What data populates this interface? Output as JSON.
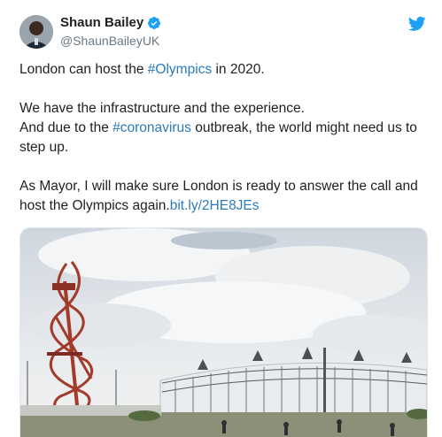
{
  "author": {
    "display_name": "Shaun Bailey",
    "handle": "@ShaunBaileyUK",
    "avatar_icon": "avatar-photo",
    "verified_icon": "verified-badge-icon"
  },
  "platform_icon": "twitter-bird-icon",
  "colors": {
    "link": "#2b7bb9",
    "verified": "#1da1f2",
    "twitter_brand": "#1da1f2",
    "text": "#1c2022",
    "muted": "#697882"
  },
  "tweet": {
    "line1_prefix": "London can host the ",
    "hashtag_olympics": "#Olympics",
    "line1_suffix": " in 2020.",
    "line2": "We have the infrastructure and the experience.",
    "line3_prefix": "And due to the ",
    "hashtag_coronavirus": "#coronavirus",
    "line3_suffix": " outbreak, the world might need us to step up.",
    "line4": "As Mayor, I will make sure London is ready to answer the call and host the Olympics again.",
    "link_text": "bit.ly/2HE8JEs"
  },
  "media": {
    "subject": "photo of ArcelorMittal Orbit tower and Olympic Stadium under cloudy sky"
  }
}
